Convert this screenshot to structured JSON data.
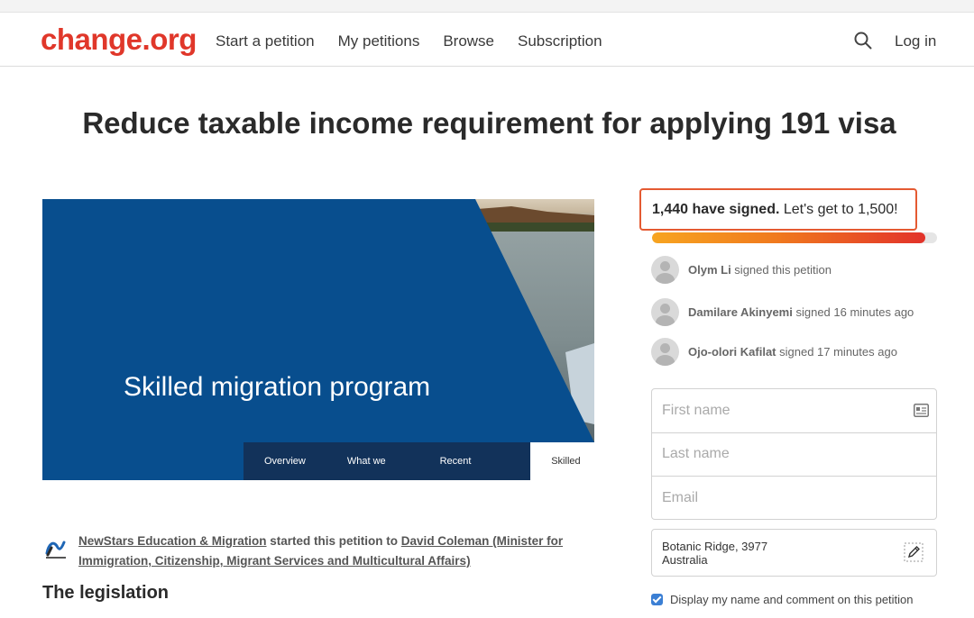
{
  "brand": {
    "logo_text": "change.org",
    "color": "#e0372a"
  },
  "nav": {
    "items": [
      "Start a petition",
      "My petitions",
      "Browse",
      "Subscription"
    ],
    "search_icon": "search-icon",
    "login_label": "Log in"
  },
  "petition": {
    "title": "Reduce taxable income requirement for applying 191 visa",
    "hero": {
      "heading": "Skilled migration program",
      "tabs": [
        "Overview",
        "What we do",
        "Recent changes",
        "Skilled vis"
      ]
    },
    "starter": {
      "org": "NewStars Education & Migration",
      "connector": " started this petition to ",
      "target": "David Coleman (Minister for Immigration, Citizenship, Migrant Services and Multicultural Affairs)"
    },
    "section_heading": "The legislation"
  },
  "signatures": {
    "count_bold": "1,440 have signed.",
    "goal_text": " Let's get to 1,500!",
    "progress": 0.96,
    "recent": [
      {
        "name": "Olym Li",
        "action": " signed this petition"
      },
      {
        "name": "Damilare Akinyemi",
        "action": " signed 16 minutes ago"
      },
      {
        "name": "Ojo-olori Kafilat",
        "action": " signed 17 minutes ago"
      }
    ]
  },
  "form": {
    "first_name_placeholder": "First name",
    "last_name_placeholder": "Last name",
    "email_placeholder": "Email",
    "address_line1": "Botanic Ridge, 3977",
    "address_line2": "Australia",
    "display_checkbox_label": "Display my name and comment on this petition",
    "display_checked": true
  }
}
